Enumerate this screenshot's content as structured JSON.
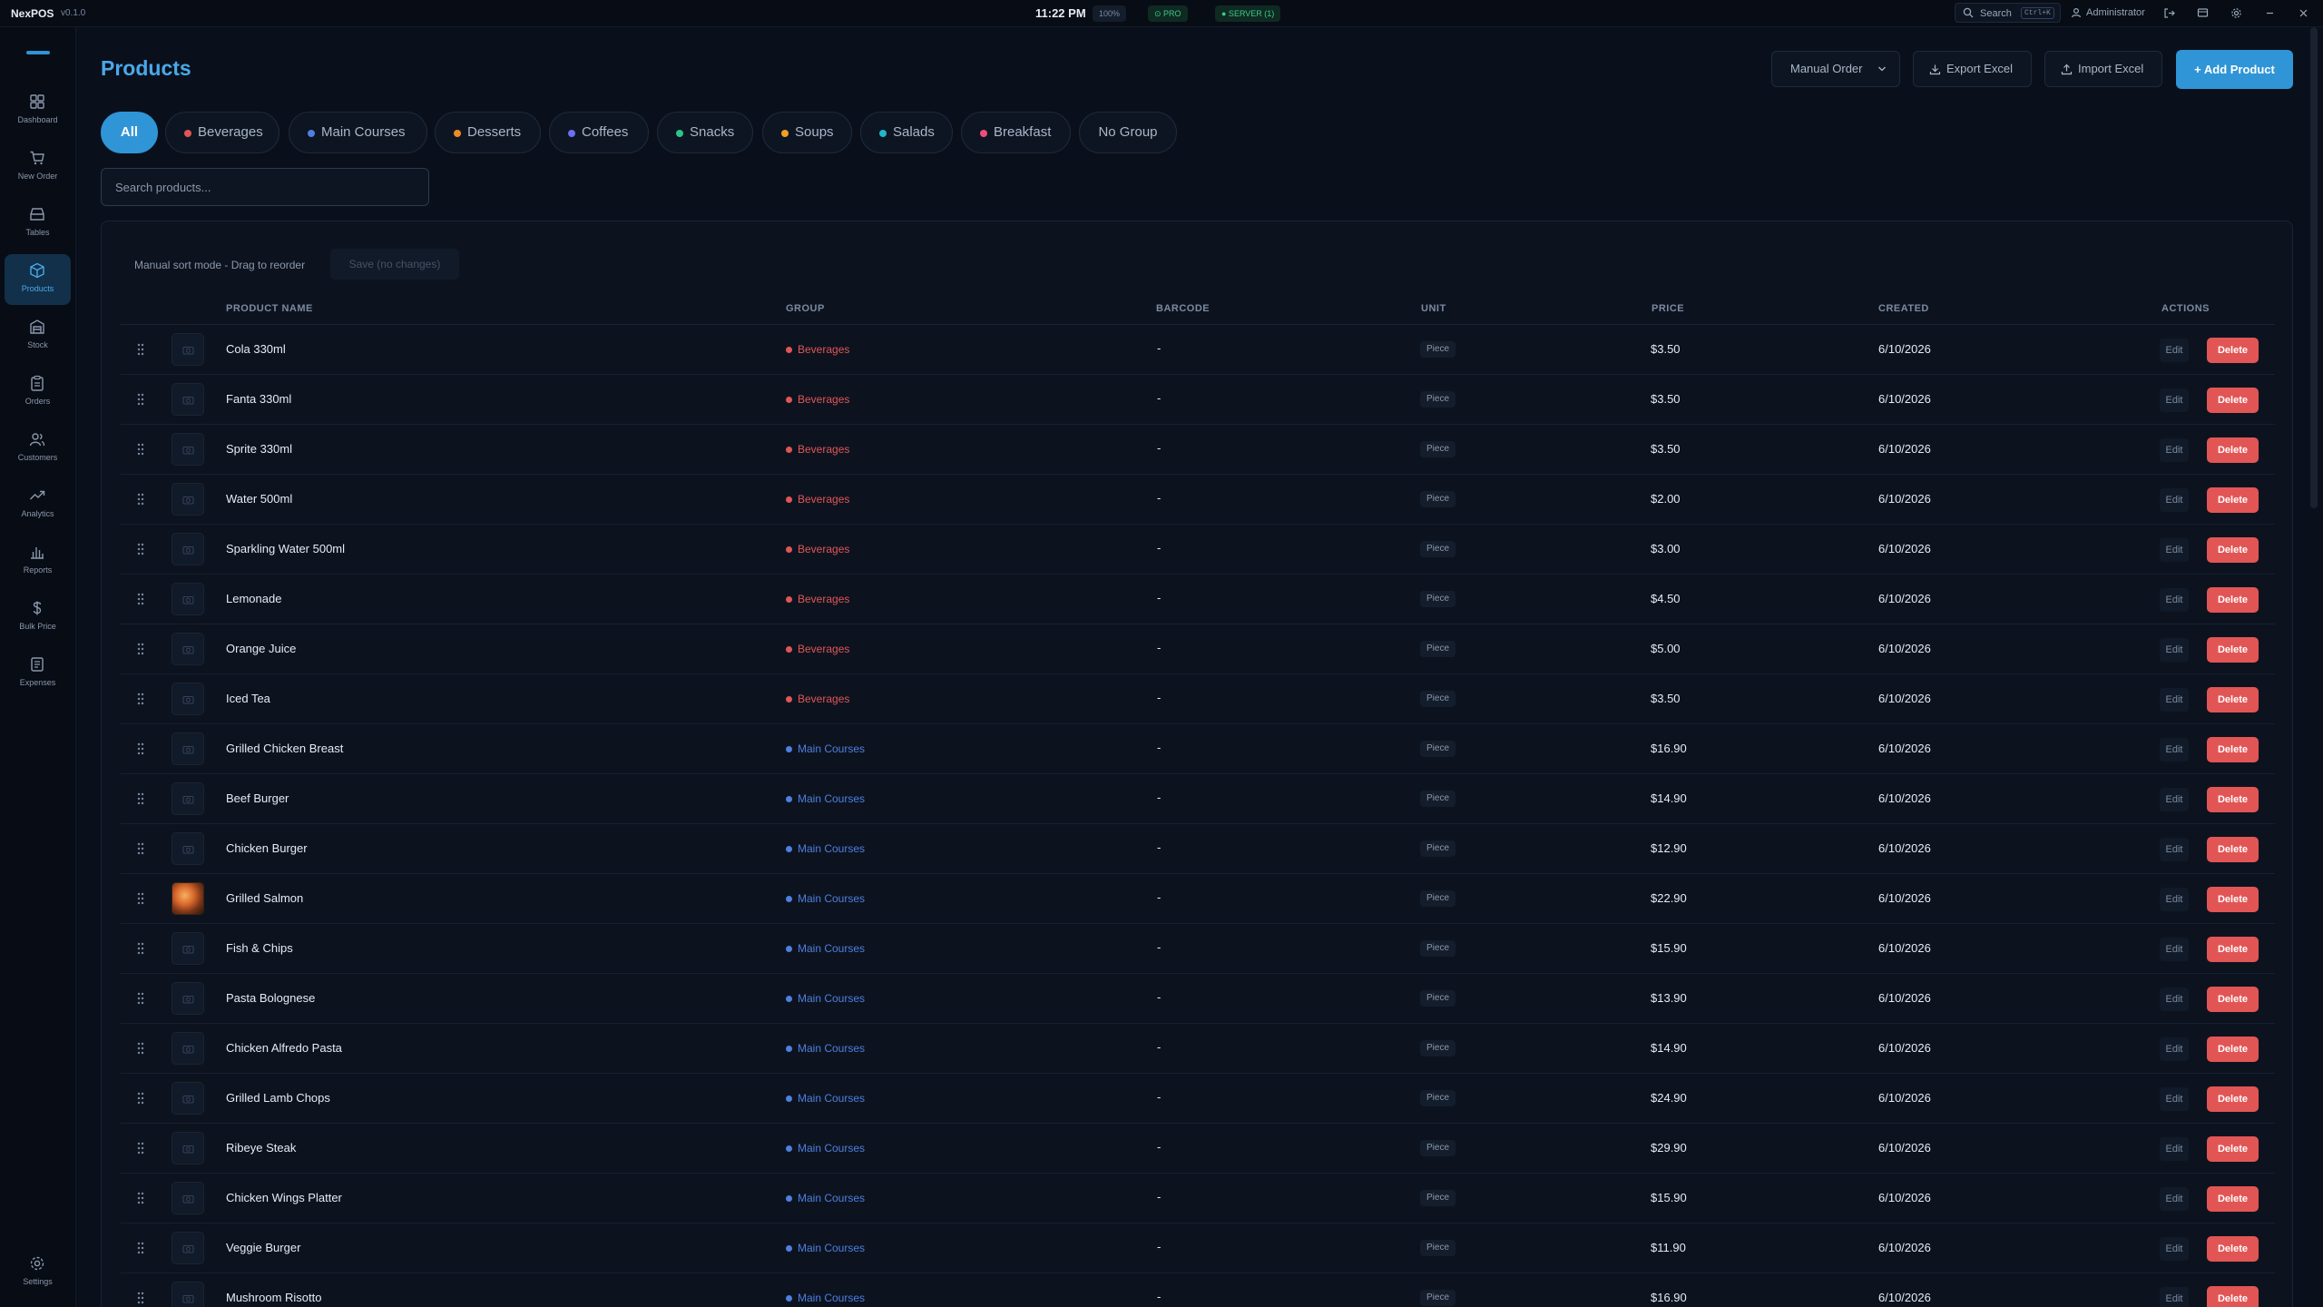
{
  "app": {
    "name": "NexPOS",
    "version": "v0.1.0"
  },
  "topbar": {
    "time": "11:22 PM",
    "zoom": "100%",
    "pro_badge": "⊙ PRO",
    "server_badge": "● SERVER (1)",
    "search_label": "Search",
    "search_shortcut": "Ctrl+K",
    "user": "Administrator"
  },
  "sidebar": {
    "items": [
      {
        "label": "Dashboard",
        "icon": "dashboard-icon"
      },
      {
        "label": "New Order",
        "icon": "cart-icon"
      },
      {
        "label": "Tables",
        "icon": "tables-icon"
      },
      {
        "label": "Products",
        "icon": "box-icon",
        "active": true
      },
      {
        "label": "Stock",
        "icon": "warehouse-icon"
      },
      {
        "label": "Orders",
        "icon": "clipboard-icon"
      },
      {
        "label": "Customers",
        "icon": "users-icon"
      },
      {
        "label": "Analytics",
        "icon": "trend-icon"
      },
      {
        "label": "Reports",
        "icon": "bar-chart-icon"
      },
      {
        "label": "Bulk Price",
        "icon": "dollar-icon"
      },
      {
        "label": "Expenses",
        "icon": "receipt-icon"
      }
    ],
    "settings_label": "Settings"
  },
  "header": {
    "title": "Products",
    "manual_order": "Manual Order",
    "export": "Export Excel",
    "import": "Import Excel",
    "add": "+ Add Product"
  },
  "tabs": [
    {
      "label": "All",
      "active": true
    },
    {
      "label": "Beverages",
      "color": "#e25555"
    },
    {
      "label": "Main Courses",
      "color": "#4f7fe0"
    },
    {
      "label": "Desserts",
      "color": "#f08a24"
    },
    {
      "label": "Coffees",
      "color": "#6b6ff0"
    },
    {
      "label": "Snacks",
      "color": "#2bc48a"
    },
    {
      "label": "Soups",
      "color": "#f0a020"
    },
    {
      "label": "Salads",
      "color": "#22b6c9"
    },
    {
      "label": "Breakfast",
      "color": "#ef4e7a"
    },
    {
      "label": "No Group"
    }
  ],
  "search": {
    "placeholder": "Search products..."
  },
  "table": {
    "sort_note": "Manual sort mode - Drag to reorder",
    "save_label": "Save (no changes)",
    "columns": [
      "PRODUCT NAME",
      "GROUP",
      "BARCODE",
      "UNIT",
      "PRICE",
      "CREATED",
      "ACTIONS"
    ],
    "edit_label": "Edit",
    "delete_label": "Delete",
    "rows": [
      {
        "name": "Cola 330ml",
        "group": "Beverages",
        "barcode": "-",
        "unit": "Piece",
        "price": "$3.50",
        "created": "6/10/2026"
      },
      {
        "name": "Fanta 330ml",
        "group": "Beverages",
        "barcode": "-",
        "unit": "Piece",
        "price": "$3.50",
        "created": "6/10/2026"
      },
      {
        "name": "Sprite 330ml",
        "group": "Beverages",
        "barcode": "-",
        "unit": "Piece",
        "price": "$3.50",
        "created": "6/10/2026"
      },
      {
        "name": "Water 500ml",
        "group": "Beverages",
        "barcode": "-",
        "unit": "Piece",
        "price": "$2.00",
        "created": "6/10/2026"
      },
      {
        "name": "Sparkling Water 500ml",
        "group": "Beverages",
        "barcode": "-",
        "unit": "Piece",
        "price": "$3.00",
        "created": "6/10/2026"
      },
      {
        "name": "Lemonade",
        "group": "Beverages",
        "barcode": "-",
        "unit": "Piece",
        "price": "$4.50",
        "created": "6/10/2026"
      },
      {
        "name": "Orange Juice",
        "group": "Beverages",
        "barcode": "-",
        "unit": "Piece",
        "price": "$5.00",
        "created": "6/10/2026"
      },
      {
        "name": "Iced Tea",
        "group": "Beverages",
        "barcode": "-",
        "unit": "Piece",
        "price": "$3.50",
        "created": "6/10/2026"
      },
      {
        "name": "Grilled Chicken Breast",
        "group": "Main Courses",
        "barcode": "-",
        "unit": "Piece",
        "price": "$16.90",
        "created": "6/10/2026"
      },
      {
        "name": "Beef Burger",
        "group": "Main Courses",
        "barcode": "-",
        "unit": "Piece",
        "price": "$14.90",
        "created": "6/10/2026"
      },
      {
        "name": "Chicken Burger",
        "group": "Main Courses",
        "barcode": "-",
        "unit": "Piece",
        "price": "$12.90",
        "created": "6/10/2026"
      },
      {
        "name": "Grilled Salmon",
        "group": "Main Courses",
        "barcode": "-",
        "unit": "Piece",
        "price": "$22.90",
        "created": "6/10/2026",
        "has_image": true
      },
      {
        "name": "Fish & Chips",
        "group": "Main Courses",
        "barcode": "-",
        "unit": "Piece",
        "price": "$15.90",
        "created": "6/10/2026"
      },
      {
        "name": "Pasta Bolognese",
        "group": "Main Courses",
        "barcode": "-",
        "unit": "Piece",
        "price": "$13.90",
        "created": "6/10/2026"
      },
      {
        "name": "Chicken Alfredo Pasta",
        "group": "Main Courses",
        "barcode": "-",
        "unit": "Piece",
        "price": "$14.90",
        "created": "6/10/2026"
      },
      {
        "name": "Grilled Lamb Chops",
        "group": "Main Courses",
        "barcode": "-",
        "unit": "Piece",
        "price": "$24.90",
        "created": "6/10/2026"
      },
      {
        "name": "Ribeye Steak",
        "group": "Main Courses",
        "barcode": "-",
        "unit": "Piece",
        "price": "$29.90",
        "created": "6/10/2026"
      },
      {
        "name": "Chicken Wings Platter",
        "group": "Main Courses",
        "barcode": "-",
        "unit": "Piece",
        "price": "$15.90",
        "created": "6/10/2026"
      },
      {
        "name": "Veggie Burger",
        "group": "Main Courses",
        "barcode": "-",
        "unit": "Piece",
        "price": "$11.90",
        "created": "6/10/2026"
      },
      {
        "name": "Mushroom Risotto",
        "group": "Main Courses",
        "barcode": "-",
        "unit": "Piece",
        "price": "$16.90",
        "created": "6/10/2026"
      }
    ]
  },
  "colors": {
    "accent": "#2f95d6",
    "delete": "#e25555",
    "beverages": "#e25555",
    "main_courses": "#4f7fe0",
    "background": "#0a101b"
  }
}
